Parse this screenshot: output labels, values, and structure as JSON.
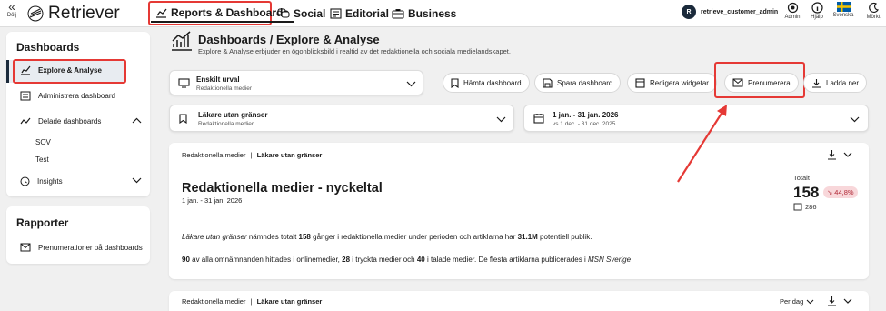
{
  "topbar": {
    "hide_label": "Dölj",
    "logo_text": "Retriever",
    "nav": [
      {
        "label": "Reports & Dashboards"
      },
      {
        "label": "Social"
      },
      {
        "label": "Editorial"
      },
      {
        "label": "Business"
      }
    ],
    "user_initial": "R",
    "user_name": "retrieve_customer_admin",
    "icons": [
      {
        "label": "Admin"
      },
      {
        "label": "Hjälp"
      },
      {
        "label": "Svenska"
      },
      {
        "label": "Mörkt"
      }
    ]
  },
  "sidebar": {
    "dashboards_title": "Dashboards",
    "explore": "Explore & Analyse",
    "administrera": "Administrera dashboard",
    "delade": "Delade dashboards",
    "sov": "SOV",
    "test": "Test",
    "insights": "Insights",
    "rapporter_title": "Rapporter",
    "prenumerationer": "Prenumerationer på dashboards"
  },
  "main": {
    "title": "Dashboards / Explore & Analyse",
    "subtitle": "Explore & Analyse erbjuder en ögonblicksbild i realtid av det redaktionella och sociala medielandskapet.",
    "urval_title": "Enskilt urval",
    "urval_sub": "Redaktionella medier",
    "buttons": {
      "hamta": "Hämta dashboard",
      "spara": "Spara dashboard",
      "redigera": "Redigera widgetar",
      "prenumerera": "Prenumerera",
      "ladda": "Ladda ner"
    },
    "filter_title": "Läkare utan gränser",
    "filter_sub": "Redaktionella medier",
    "date_title": "1 jan. - 31 jan. 2026",
    "date_sub": "vs 1 dec. - 31 dec. 2025",
    "widget1": {
      "crumb_source": "Redaktionella medier",
      "crumb_sep": "|",
      "crumb_topic": "Läkare utan gränser",
      "title": "Redaktionella medier - nyckeltal",
      "date": "1 jan. - 31 jan. 2026",
      "total_label": "Totalt",
      "total_value": "158",
      "change": "44,8%",
      "secondary_value": "286",
      "p1_topic": "Läkare utan gränser",
      "p1_a": " nämndes totalt ",
      "p1_count": "158",
      "p1_b": " gånger i redaktionella medier under perioden och artiklarna har ",
      "p1_reach": "31.1M",
      "p1_c": " potentiell publik.",
      "p2_online": "90",
      "p2_a": " av alla omnämnanden hittades i onlinemedier, ",
      "p2_print": "28",
      "p2_b": " i tryckta medier och ",
      "p2_broadcast": "40",
      "p2_c": " i talade medier. De flesta artiklarna publicerades i ",
      "p2_source": "MSN Sverige"
    },
    "widget2": {
      "crumb_source": "Redaktionella medier",
      "crumb_sep": "|",
      "crumb_topic": "Läkare utan gränser",
      "per_dag": "Per dag"
    }
  },
  "colors": {
    "accent_red": "#e53935",
    "badge_bg": "#f8d7da",
    "badge_fg": "#b02a37",
    "dark": "#1b2a3b"
  }
}
